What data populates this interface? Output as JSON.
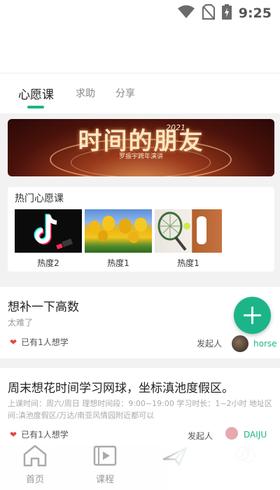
{
  "status_bar": {
    "time": "9:25",
    "icons": [
      "wifi-icon",
      "no-sim-icon",
      "battery-charging-icon"
    ]
  },
  "tabs": [
    {
      "label": "心愿课",
      "active": true
    },
    {
      "label": "求助",
      "active": false
    },
    {
      "label": "分享",
      "active": false
    }
  ],
  "banner": {
    "title": "时间的朋友",
    "year": "2021",
    "subtitle": "罗振宇跨年演讲"
  },
  "hot_courses": {
    "title": "热门心愿课",
    "items": [
      {
        "label": "热度2",
        "image": "tiktok-logo"
      },
      {
        "label": "热度1",
        "image": "tulips"
      },
      {
        "label": "热度1",
        "image": "tennis"
      }
    ]
  },
  "posts": [
    {
      "title": "想补一下高数",
      "subtitle": "太难了",
      "likes": "已有1人想学",
      "initiator_label": "发起人",
      "username": "horse"
    },
    {
      "title": "周末想花时间学习网球，坐标滇池度假区。",
      "description": "上课时间：周六/周日 理想时间段：9:00~19:00 学习时长：1~2小时 地址区间:滇池度假区/万达/南亚风情园附近都可以",
      "likes": "已有1人想学",
      "initiator_label": "发起人",
      "username": "DAIJU"
    }
  ],
  "bottom_nav": [
    {
      "label": "首页",
      "icon": "home-icon"
    },
    {
      "label": "课程",
      "icon": "video-icon"
    },
    {
      "label": "",
      "icon": "paper-plane-icon"
    },
    {
      "label": "",
      "icon": "chat-icon"
    }
  ],
  "colors": {
    "accent": "#1cb58a",
    "heart": "#e04a4a",
    "background": "#f2f2f2"
  }
}
